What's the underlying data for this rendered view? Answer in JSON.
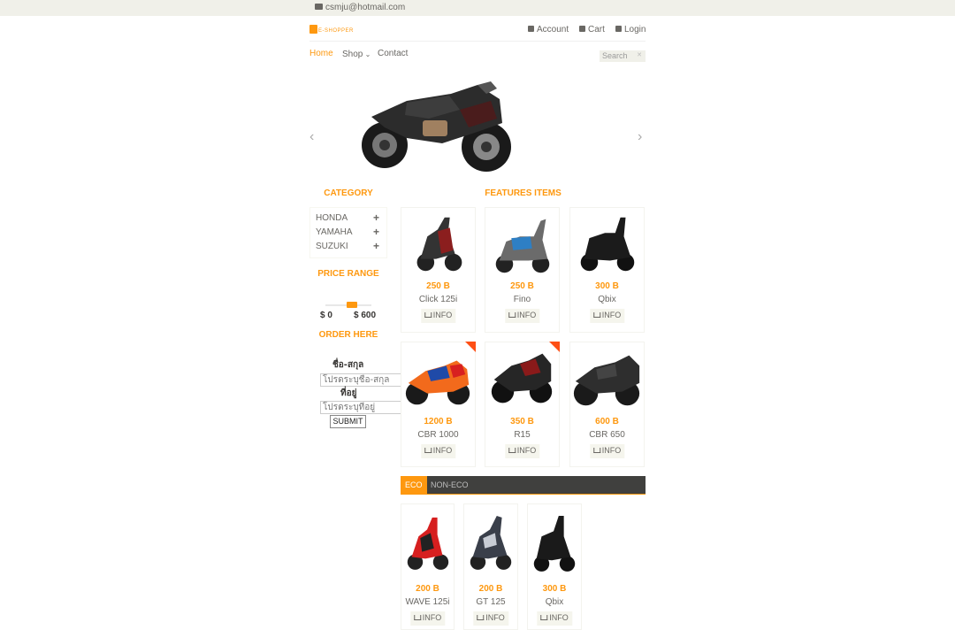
{
  "topbar": {
    "email": "csmju@hotmail.com"
  },
  "header": {
    "logo": "E-SHOPPER",
    "account": "Account",
    "cart": "Cart",
    "login": "Login"
  },
  "nav": {
    "home": "Home",
    "shop": "Shop",
    "contact": "Contact",
    "search_placeholder": "Search"
  },
  "sidebar": {
    "category_title": "CATEGORY",
    "categories": [
      "HONDA",
      "YAMAHA",
      "SUZUKI"
    ],
    "price_title": "PRICE RANGE",
    "price_min": "$ 0",
    "price_max": "$ 600",
    "order_title": "ORDER HERE",
    "name_label": "ชื่อ-สกุล",
    "name_placeholder": "โปรดระบุชื่อ-สกุล",
    "address_label": "ที่อยู่",
    "address_placeholder": "โปรดระบุที่อยู่",
    "submit": "SUBMIT"
  },
  "features": {
    "title": "FEATURES ITEMS",
    "items": [
      {
        "price": "250 B",
        "name": "Click 125i",
        "info": "INFO"
      },
      {
        "price": "250 B",
        "name": "Fino",
        "info": "INFO"
      },
      {
        "price": "300 B",
        "name": "Qbix",
        "info": "INFO"
      },
      {
        "price": "1200 B",
        "name": "CBR 1000",
        "info": "INFO"
      },
      {
        "price": "350 B",
        "name": "R15",
        "info": "INFO"
      },
      {
        "price": "600 B",
        "name": "CBR 650",
        "info": "INFO"
      }
    ]
  },
  "tabs": {
    "eco": "ECO",
    "non_eco": "NON-ECO",
    "items": [
      {
        "price": "200 B",
        "name": "WAVE 125i",
        "info": "INFO"
      },
      {
        "price": "200 B",
        "name": "GT 125",
        "info": "INFO"
      },
      {
        "price": "300 B",
        "name": "Qbix",
        "info": "INFO"
      }
    ]
  },
  "colors": {
    "accent": "#FE980F",
    "ribbon": "#fe4f14",
    "tabbar": "#40403e"
  }
}
